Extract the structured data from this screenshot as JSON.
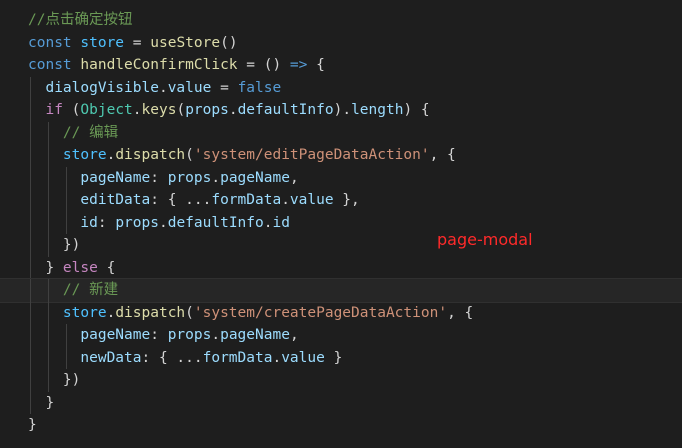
{
  "editor": {
    "annotation_label": "page-modal",
    "lines": [
      [
        {
          "t": "//点击确定按钮",
          "c": "cm"
        }
      ],
      [
        {
          "t": "const",
          "c": "kw"
        },
        {
          "t": " ",
          "c": "pun"
        },
        {
          "t": "store",
          "c": "const"
        },
        {
          "t": " = ",
          "c": "pun"
        },
        {
          "t": "useStore",
          "c": "fn"
        },
        {
          "t": "()",
          "c": "pun"
        }
      ],
      [
        {
          "t": "const",
          "c": "kw"
        },
        {
          "t": " ",
          "c": "pun"
        },
        {
          "t": "handleConfirmClick",
          "c": "fn"
        },
        {
          "t": " = () ",
          "c": "pun"
        },
        {
          "t": "=>",
          "c": "kw"
        },
        {
          "t": " {",
          "c": "pun"
        }
      ],
      [
        {
          "t": "  ",
          "c": "pun"
        },
        {
          "t": "dialogVisible",
          "c": "var"
        },
        {
          "t": ".",
          "c": "pun"
        },
        {
          "t": "value",
          "c": "var"
        },
        {
          "t": " = ",
          "c": "pun"
        },
        {
          "t": "false",
          "c": "kw"
        }
      ],
      [
        {
          "t": "  ",
          "c": "pun"
        },
        {
          "t": "if",
          "c": "ctl"
        },
        {
          "t": " (",
          "c": "pun"
        },
        {
          "t": "Object",
          "c": "cls"
        },
        {
          "t": ".",
          "c": "pun"
        },
        {
          "t": "keys",
          "c": "fn"
        },
        {
          "t": "(",
          "c": "pun"
        },
        {
          "t": "props",
          "c": "var"
        },
        {
          "t": ".",
          "c": "pun"
        },
        {
          "t": "defaultInfo",
          "c": "var"
        },
        {
          "t": ").",
          "c": "pun"
        },
        {
          "t": "length",
          "c": "var"
        },
        {
          "t": ") {",
          "c": "pun"
        }
      ],
      [
        {
          "t": "    ",
          "c": "pun"
        },
        {
          "t": "// 编辑",
          "c": "cm"
        }
      ],
      [
        {
          "t": "    ",
          "c": "pun"
        },
        {
          "t": "store",
          "c": "const"
        },
        {
          "t": ".",
          "c": "pun"
        },
        {
          "t": "dispatch",
          "c": "fn"
        },
        {
          "t": "(",
          "c": "pun"
        },
        {
          "t": "'system/editPageDataAction'",
          "c": "str"
        },
        {
          "t": ", {",
          "c": "pun"
        }
      ],
      [
        {
          "t": "      ",
          "c": "pun"
        },
        {
          "t": "pageName",
          "c": "var"
        },
        {
          "t": ": ",
          "c": "pun"
        },
        {
          "t": "props",
          "c": "var"
        },
        {
          "t": ".",
          "c": "pun"
        },
        {
          "t": "pageName",
          "c": "var"
        },
        {
          "t": ",",
          "c": "pun"
        }
      ],
      [
        {
          "t": "      ",
          "c": "pun"
        },
        {
          "t": "editData",
          "c": "var"
        },
        {
          "t": ": { ...",
          "c": "pun"
        },
        {
          "t": "formData",
          "c": "var"
        },
        {
          "t": ".",
          "c": "pun"
        },
        {
          "t": "value",
          "c": "var"
        },
        {
          "t": " },",
          "c": "pun"
        }
      ],
      [
        {
          "t": "      ",
          "c": "pun"
        },
        {
          "t": "id",
          "c": "var"
        },
        {
          "t": ": ",
          "c": "pun"
        },
        {
          "t": "props",
          "c": "var"
        },
        {
          "t": ".",
          "c": "pun"
        },
        {
          "t": "defaultInfo",
          "c": "var"
        },
        {
          "t": ".",
          "c": "pun"
        },
        {
          "t": "id",
          "c": "var"
        }
      ],
      [
        {
          "t": "    })",
          "c": "pun"
        }
      ],
      [
        {
          "t": "  } ",
          "c": "pun"
        },
        {
          "t": "else",
          "c": "ctl"
        },
        {
          "t": " {",
          "c": "pun"
        }
      ],
      [
        {
          "t": "    ",
          "c": "pun"
        },
        {
          "t": "// 新建",
          "c": "cm"
        }
      ],
      [
        {
          "t": "    ",
          "c": "pun"
        },
        {
          "t": "store",
          "c": "const"
        },
        {
          "t": ".",
          "c": "pun"
        },
        {
          "t": "dispatch",
          "c": "fn"
        },
        {
          "t": "(",
          "c": "pun"
        },
        {
          "t": "'system/createPageDataAction'",
          "c": "str"
        },
        {
          "t": ", {",
          "c": "pun"
        }
      ],
      [
        {
          "t": "      ",
          "c": "pun"
        },
        {
          "t": "pageName",
          "c": "var"
        },
        {
          "t": ": ",
          "c": "pun"
        },
        {
          "t": "props",
          "c": "var"
        },
        {
          "t": ".",
          "c": "pun"
        },
        {
          "t": "pageName",
          "c": "var"
        },
        {
          "t": ",",
          "c": "pun"
        }
      ],
      [
        {
          "t": "      ",
          "c": "pun"
        },
        {
          "t": "newData",
          "c": "var"
        },
        {
          "t": ": { ...",
          "c": "pun"
        },
        {
          "t": "formData",
          "c": "var"
        },
        {
          "t": ".",
          "c": "pun"
        },
        {
          "t": "value",
          "c": "var"
        },
        {
          "t": " }",
          "c": "pun"
        }
      ],
      [
        {
          "t": "    })",
          "c": "pun"
        }
      ],
      [
        {
          "t": "  }",
          "c": "pun"
        }
      ],
      [
        {
          "t": "}",
          "c": "pun"
        }
      ]
    ],
    "current_line": 12,
    "colors": {
      "background": "#1e1e1e",
      "comment": "#6a9955",
      "keyword": "#569cd6",
      "control": "#c586c0",
      "variable": "#9cdcfe",
      "constant": "#4fc1ff",
      "function": "#dcdcaa",
      "class": "#4ec9b0",
      "string": "#ce9178",
      "annotation": "#ff2a2a"
    }
  }
}
